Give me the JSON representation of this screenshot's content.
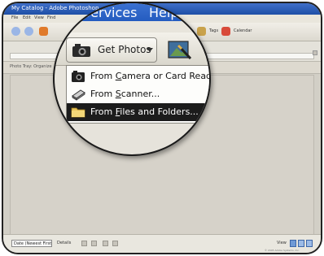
{
  "window": {
    "title": "My Catalog - Adobe Photoshop",
    "menus": [
      "File",
      "Edit",
      "View",
      "Find"
    ]
  },
  "toolbar": {
    "get_photos": "Get Photos",
    "tags_label": "Tags",
    "calendar_label": "Calendar"
  },
  "tag_bar": {
    "text": "Photo Tray: Organize"
  },
  "status_bar": {
    "sort_value": "Date (Newest First)",
    "details_label": "Details",
    "view_label": "View"
  },
  "copyright": "© 2005 Adobe Systems, Inc.",
  "magnifier": {
    "menu_services": "Services",
    "menu_help": "Help",
    "get_photos_label": "Get Photos",
    "dropdown_items": [
      {
        "prefix": "From ",
        "mnemonic": "C",
        "rest": "amera or Card Reader..."
      },
      {
        "prefix": "From ",
        "mnemonic": "S",
        "rest": "canner..."
      },
      {
        "prefix": "From ",
        "mnemonic": "F",
        "rest": "iles and Folders..."
      }
    ],
    "selected_index": 2
  }
}
